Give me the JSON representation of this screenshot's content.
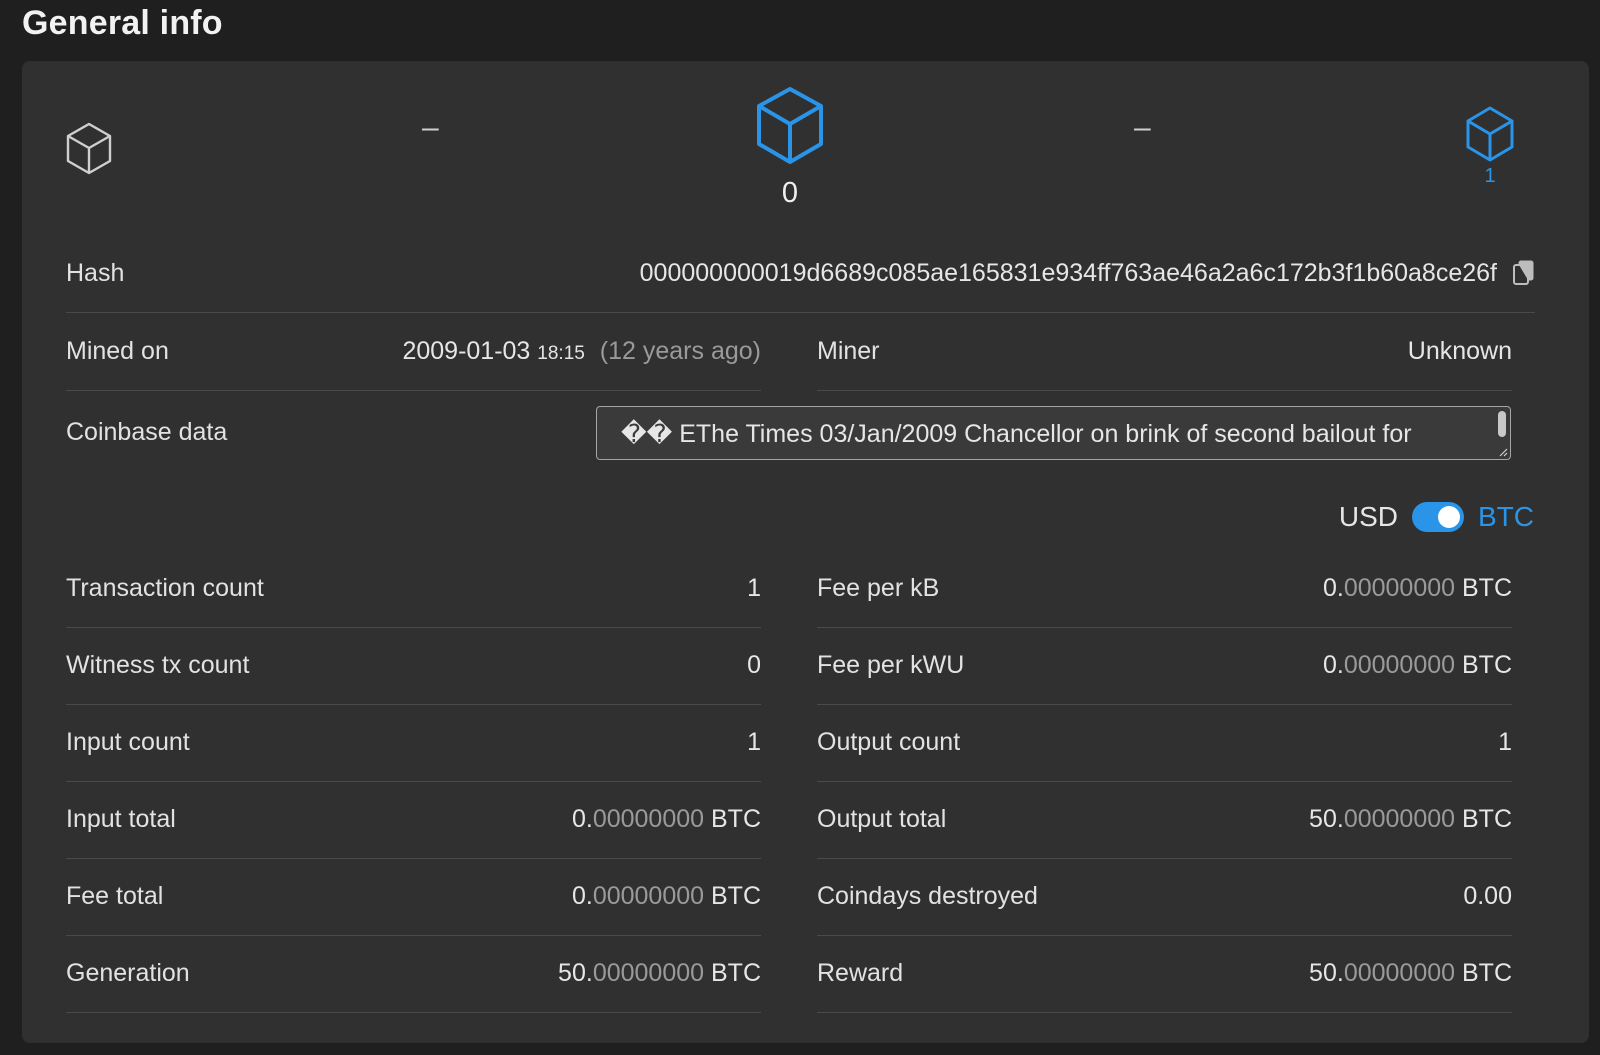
{
  "page": {
    "title": "General info"
  },
  "nav": {
    "prev_dash": "–",
    "next_dash": "–",
    "current_block": "0",
    "next_block": "1"
  },
  "hash": {
    "label": "Hash",
    "value": "000000000019d6689c085ae165831e934ff763ae46a2a6c172b3f1b60a8ce26f"
  },
  "mined_on": {
    "label": "Mined on",
    "date": "2009-01-03",
    "time": "18:15",
    "relative": "(12 years ago)"
  },
  "miner": {
    "label": "Miner",
    "value": "Unknown"
  },
  "coinbase": {
    "label": "Coinbase data",
    "value": "�� EThe Times 03/Jan/2009 Chancellor on brink of second bailout for"
  },
  "currency_toggle": {
    "left": "USD",
    "right": "BTC"
  },
  "left_rows": [
    {
      "label": "Transaction count",
      "value": "1"
    },
    {
      "label": "Witness tx count",
      "value": "0"
    },
    {
      "label": "Input count",
      "value": "1"
    },
    {
      "label": "Input total",
      "int": "0.",
      "frac": "00000000",
      "unit": " BTC"
    },
    {
      "label": "Fee total",
      "int": "0.",
      "frac": "00000000",
      "unit": " BTC"
    },
    {
      "label": "Generation",
      "int": "50.",
      "frac": "00000000",
      "unit": " BTC"
    }
  ],
  "right_rows": [
    {
      "label": "Fee per kB",
      "int": "0.",
      "frac": "00000000",
      "unit": " BTC"
    },
    {
      "label": "Fee per kWU",
      "int": "0.",
      "frac": "00000000",
      "unit": " BTC"
    },
    {
      "label": "Output count",
      "value": "1"
    },
    {
      "label": "Output total",
      "int": "50.",
      "frac": "00000000",
      "unit": " BTC"
    },
    {
      "label": "Coindays destroyed",
      "value": "0.00"
    },
    {
      "label": "Reward",
      "int": "50.",
      "frac": "00000000",
      "unit": " BTC"
    }
  ]
}
